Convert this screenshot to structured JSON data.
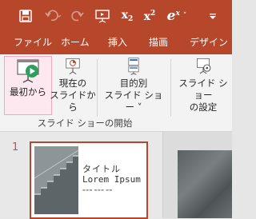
{
  "qat": {
    "save_icon": "save-icon",
    "undo_icon": "undo-icon",
    "redo_icon": "redo-icon",
    "present_icon": "present-icon",
    "subscript_label": "x",
    "subscript_sub": "2",
    "superscript_label": "x",
    "superscript_sup": "2",
    "equation_label": "e",
    "equation_sup": "x",
    "equation_caret": "˅",
    "customize_icon": "customize-qat-icon"
  },
  "tabs": [
    {
      "label": "ファイル",
      "active": false
    },
    {
      "label": "ホーム",
      "active": false
    },
    {
      "label": "挿入",
      "active": false
    },
    {
      "label": "描画",
      "active": false
    },
    {
      "label": "デザイン",
      "active": false
    }
  ],
  "ribbon": {
    "group_label": "スライド ショーの開始",
    "buttons": [
      {
        "line1": "最初から",
        "line2": "",
        "icon": "play-from-start-icon"
      },
      {
        "line1": "現在の",
        "line2": "スライドから",
        "icon": "play-from-current-icon"
      },
      {
        "line1": "目的別",
        "line2": "スライド ショー ˅",
        "icon": "custom-show-icon"
      },
      {
        "line1": "スライド ショー",
        "line2": "の設定",
        "icon": "setup-show-icon"
      }
    ]
  },
  "thumbnails": {
    "slide_number": "1",
    "title": "タイトル",
    "subtitle": "Lorem Ipsum"
  },
  "colors": {
    "accent": "#b7472a",
    "ribbon_bg": "#f3f3f3",
    "selected_border": "#f1a7c1"
  }
}
